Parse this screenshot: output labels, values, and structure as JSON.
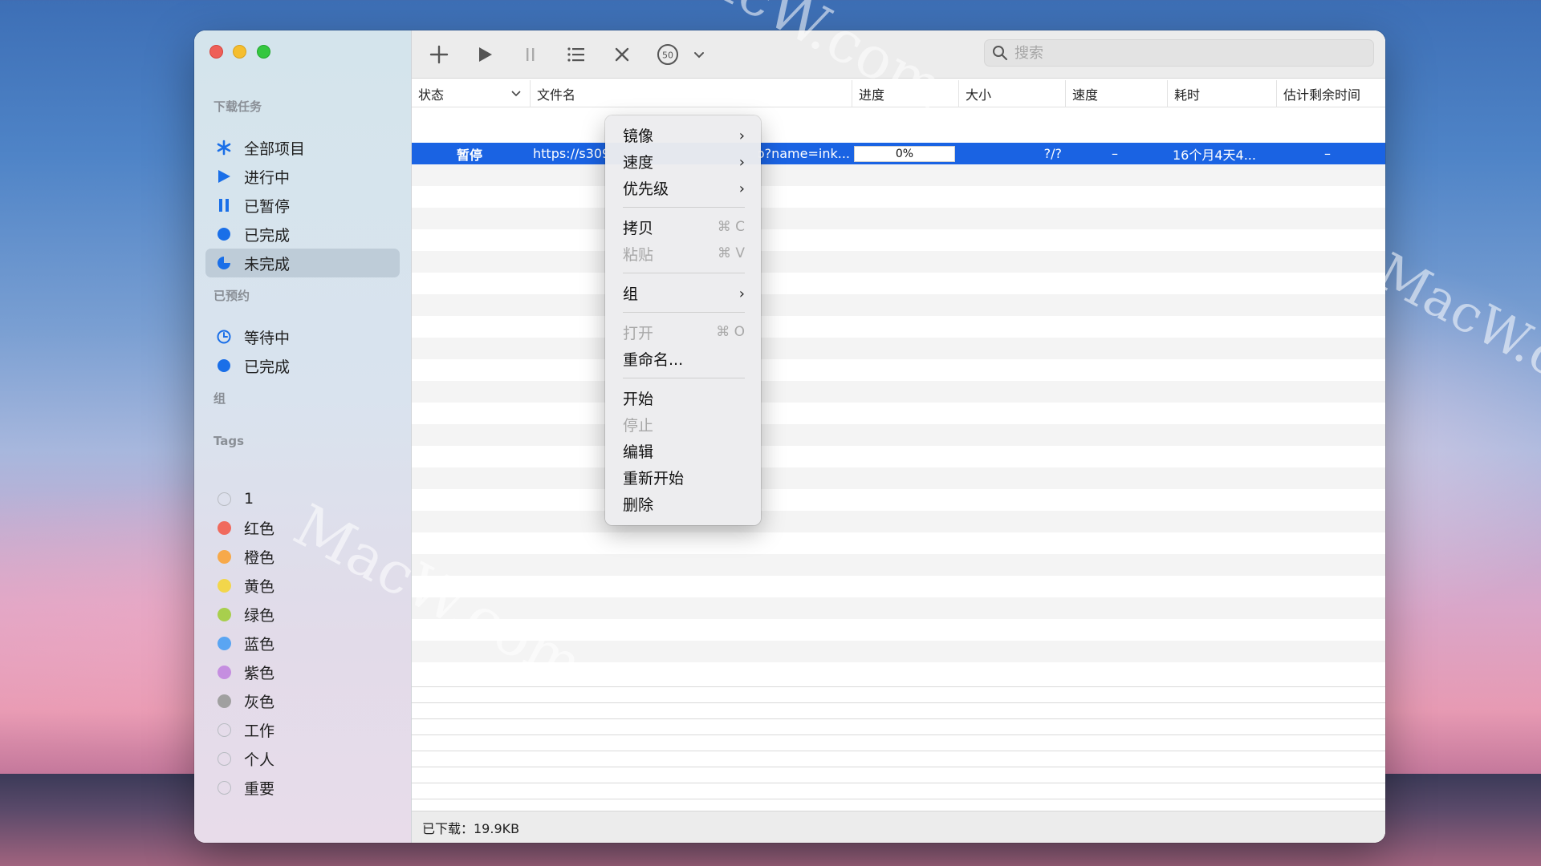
{
  "sidebar": {
    "section_downloads": "下载任务",
    "downloads": [
      {
        "label": "全部项目",
        "icon": "asterisk-icon"
      },
      {
        "label": "进行中",
        "icon": "play-icon"
      },
      {
        "label": "已暂停",
        "icon": "pause-icon"
      },
      {
        "label": "已完成",
        "icon": "circle-filled-icon"
      },
      {
        "label": "未完成",
        "icon": "half-moon-icon"
      }
    ],
    "section_scheduled": "已预约",
    "scheduled": [
      {
        "label": "等待中",
        "icon": "clock-icon"
      },
      {
        "label": "已完成",
        "icon": "circle-filled-icon"
      }
    ],
    "section_groups": "组",
    "section_tags": "Tags",
    "tags": [
      {
        "label": "1",
        "color": ""
      },
      {
        "label": "红色",
        "color": "#f06a5d"
      },
      {
        "label": "橙色",
        "color": "#f7a94a"
      },
      {
        "label": "黄色",
        "color": "#f2d64b"
      },
      {
        "label": "绿色",
        "color": "#a8cf4d"
      },
      {
        "label": "蓝色",
        "color": "#5aa5f2"
      },
      {
        "label": "紫色",
        "color": "#c58ee0"
      },
      {
        "label": "灰色",
        "color": "#a0a0a0"
      },
      {
        "label": "工作",
        "color": ""
      },
      {
        "label": "个人",
        "color": ""
      },
      {
        "label": "重要",
        "color": ""
      }
    ]
  },
  "toolbar": {
    "buttons": [
      "add-icon",
      "play-icon",
      "pause-icon",
      "list-icon",
      "close-icon",
      "speed-limit-icon",
      "chevron-down-icon"
    ],
    "speed_badge": "50",
    "search_placeholder": "搜索"
  },
  "table": {
    "columns": [
      "状态",
      "文件名",
      "进度",
      "大小",
      "速度",
      "耗时",
      "估计剩余时间"
    ],
    "rows": [
      {
        "status": "暂停",
        "filename_start": "https://s309",
        "filename_end": "o?name=ink...",
        "progress": "0%",
        "progress_fraction": 0,
        "size": "?/?",
        "speed": "–",
        "elapsed": "16个月4天4...",
        "remaining": "–"
      }
    ]
  },
  "status_bar": {
    "downloaded": "已下载：19.9KB"
  },
  "context_menu": {
    "items": [
      {
        "label": "镜像",
        "submenu": true
      },
      {
        "label": "速度",
        "submenu": true
      },
      {
        "label": "优先级",
        "submenu": true
      },
      {
        "label": "拷贝",
        "shortcut": "⌘ C"
      },
      {
        "label": "粘贴",
        "shortcut": "⌘ V",
        "disabled": true
      },
      {
        "label": "组",
        "submenu": true
      },
      {
        "label": "打开",
        "shortcut": "⌘ O",
        "disabled": true
      },
      {
        "label": "重命名..."
      },
      {
        "label": "开始"
      },
      {
        "label": "停止",
        "disabled": true
      },
      {
        "label": "编辑"
      },
      {
        "label": "重新开始"
      },
      {
        "label": "删除"
      }
    ]
  },
  "colors": {
    "accent": "#1a63e3",
    "selection": "#1a63e3"
  },
  "watermark": "MacW.com"
}
